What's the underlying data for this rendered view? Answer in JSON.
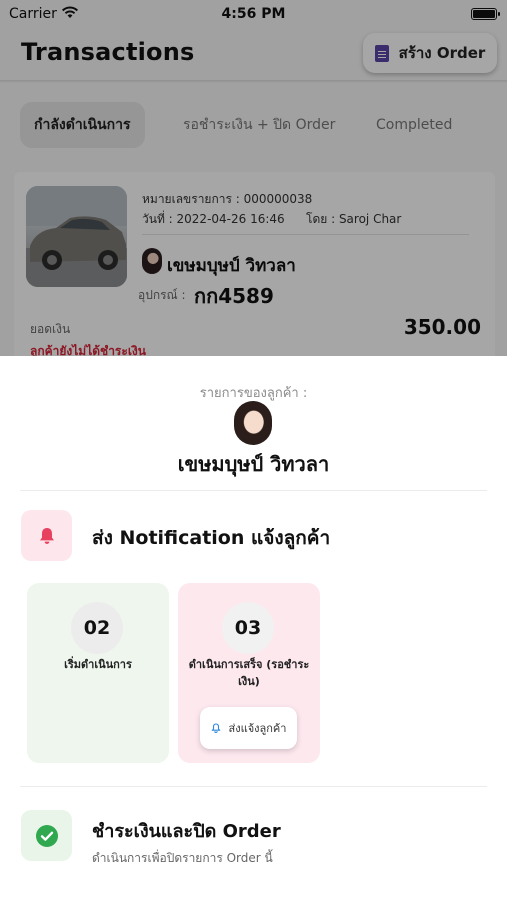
{
  "status_bar": {
    "carrier": "Carrier",
    "time": "4:56 PM"
  },
  "header": {
    "title": "Transactions",
    "create_label": "สร้าง Order"
  },
  "tabs": [
    {
      "label": "กำลังดำเนินการ",
      "active": true
    },
    {
      "label": "รอชำระเงิน + ปิด Order",
      "active": false
    },
    {
      "label": "Completed",
      "active": false
    }
  ],
  "order_card": {
    "order_no": "หมายเลขรายการ : 000000038",
    "date": "วันที่ : 2022-04-26 16:46",
    "by": "โดย : Saroj Char",
    "customer": "เขษมบุษป์ วิทวลา",
    "device_label": "อุปกรณ์ :",
    "device_value": "กก4589",
    "amount_label": "ยอดเงิน",
    "amount_value": "350.00",
    "payment_status": "ลูกค้ายังไม่ได้ชำระเงิน"
  },
  "sheet": {
    "caption": "รายการของลูกค้า :",
    "customer_name": "เขษมบุษป์ วิทวลา",
    "notify_title": "ส่ง Notification แจ้งลูกค้า",
    "steps": [
      {
        "number": "02",
        "label": "เริ่มดำเนินการ"
      },
      {
        "number": "03",
        "label": "ดำเนินการเสร็จ (รอชำระเงิน)",
        "button_label": "ส่งแจ้งลูกค้า"
      }
    ],
    "pay_title": "ชำระเงินและปิด Order",
    "pay_subtitle": "ดำเนินการเพื่อปิดรายการ Order นี้"
  },
  "colors": {
    "notify_accent": "#e8415f",
    "pay_accent": "#2fa84f",
    "unpaid_text": "#d9263a",
    "create_icon": "#5b45a8"
  },
  "icons": {
    "wifi": "wifi-icon",
    "battery": "battery-icon",
    "create": "document-icon",
    "notify": "bell-icon",
    "pill": "bell-icon",
    "pay": "check-circle-icon"
  }
}
